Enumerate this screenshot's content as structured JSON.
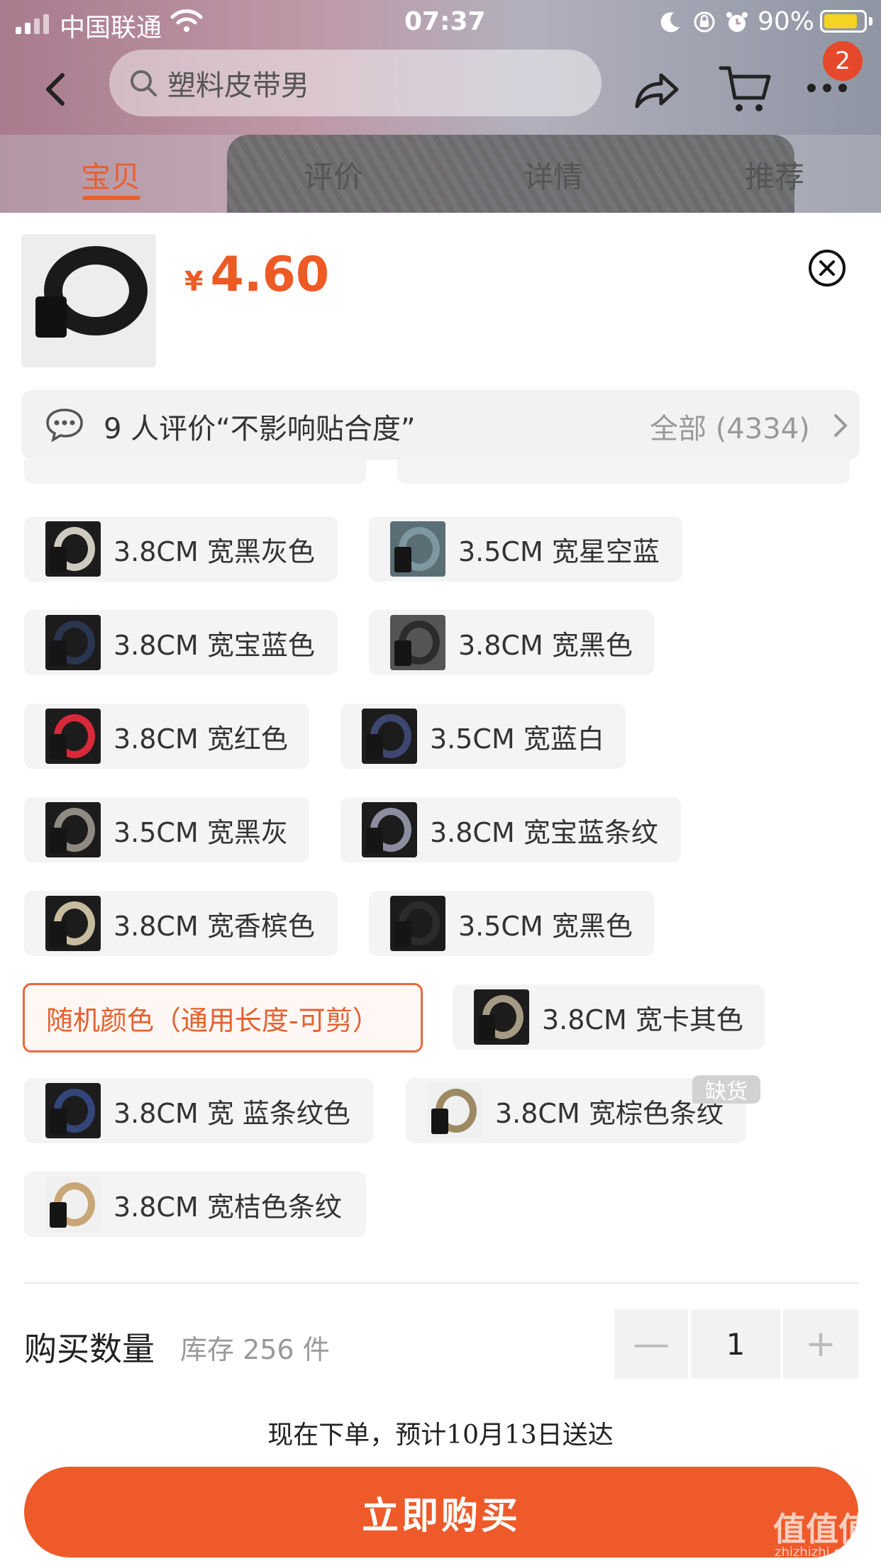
{
  "status_bar": {
    "carrier": "中国联通",
    "time": "07:37",
    "battery": "90%"
  },
  "nav": {
    "search_placeholder": "塑料皮带男",
    "cart_badge": "2"
  },
  "tabs": [
    {
      "label": "宝贝",
      "active": true
    },
    {
      "label": "评价",
      "active": false
    },
    {
      "label": "详情",
      "active": false
    },
    {
      "label": "推荐",
      "active": false
    }
  ],
  "product": {
    "currency": "¥",
    "price": "4.60"
  },
  "reviews": {
    "summary": "9 人评价“不影响贴合度”",
    "all_label": "全部 (4334)"
  },
  "options": [
    {
      "label": "3.8CM 宽黑灰色",
      "swatch": "#cfcac0",
      "selected": false
    },
    {
      "label": "3.5CM 宽星空蓝",
      "swatch": "#5f7d86",
      "selected": false
    },
    {
      "label": "3.8CM 宽宝蓝色",
      "swatch": "#2a3550",
      "selected": false
    },
    {
      "label": "3.8CM 宽黑色",
      "swatch": "#3a3a3a",
      "selected": false
    },
    {
      "label": "3.8CM 宽红色",
      "swatch": "#d8293b",
      "selected": false
    },
    {
      "label": "3.5CM 宽蓝白",
      "swatch": "#3d4770",
      "selected": false
    },
    {
      "label": "3.5CM 宽黑灰",
      "swatch": "#8f8a82",
      "selected": false
    },
    {
      "label": "3.8CM 宽宝蓝条纹",
      "swatch": "#8c8ea0",
      "selected": false
    },
    {
      "label": "3.8CM 宽香槟色",
      "swatch": "#c8bca0",
      "selected": false
    },
    {
      "label": "3.5CM 宽黑色",
      "swatch": "#2b2b2b",
      "selected": false
    },
    {
      "label": "随机颜色（通用长度-可剪）",
      "swatch": "",
      "selected": true
    },
    {
      "label": "3.8CM 宽卡其色",
      "swatch": "#a59a84",
      "selected": false
    },
    {
      "label": "3.8CM 宽 蓝条纹色",
      "swatch": "#34457a",
      "selected": false
    },
    {
      "label": "3.8CM 宽棕色条纹",
      "swatch": "#9d8a63",
      "selected": false
    },
    {
      "label": "3.8CM 宽桔色条纹",
      "swatch": "#c9a676",
      "selected": false
    }
  ],
  "out_of_stock_label": "缺货",
  "quantity": {
    "label": "购买数量",
    "stock": "库存 256 件",
    "minus": "—",
    "value": "1",
    "plus": "+"
  },
  "delivery": "现在下单，预计10月13日送达",
  "buy_button": "立即购买",
  "watermark": {
    "main": "值值值",
    "sub": "zhizhizhi.com"
  },
  "colors": {
    "accent": "#ee5a24",
    "selected_border": "#e56a3f"
  }
}
